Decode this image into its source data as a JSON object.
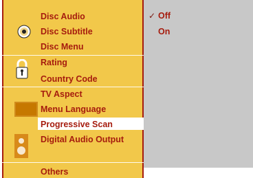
{
  "menu": {
    "groups": [
      {
        "items": [
          "Disc Audio",
          "Disc Subtitle",
          "Disc Menu"
        ],
        "icon": "disc-icon"
      },
      {
        "items": [
          "Rating",
          "Country Code"
        ],
        "icon": "lock-icon"
      },
      {
        "items": [
          "TV Aspect",
          "Menu Language",
          "Progressive Scan"
        ],
        "icon": "tv-screen-icon"
      },
      {
        "items": [
          "Digital Audio Output"
        ],
        "icon": "speaker-icon"
      },
      {
        "items": [
          "Others"
        ],
        "icon": ""
      }
    ],
    "selected": "Progressive Scan"
  },
  "options": {
    "items": [
      "Off",
      "On"
    ],
    "checked": "Off",
    "check_mark": "✓"
  },
  "colors": {
    "menu_bg": "#f2c84a",
    "text": "#a61c0e",
    "options_bg": "#c8c8c8",
    "highlight": "#ffffff"
  }
}
